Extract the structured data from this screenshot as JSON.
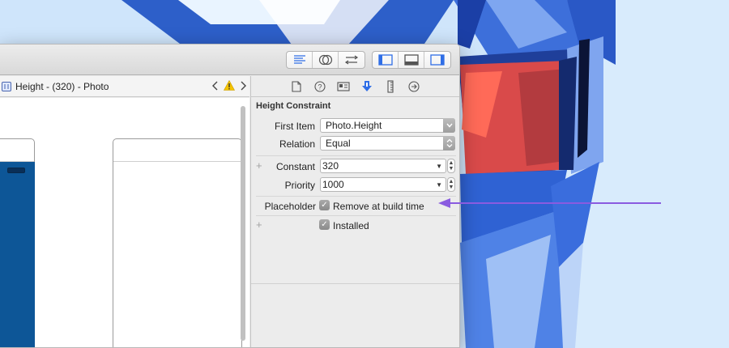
{
  "editor": {
    "breadcrumb": "Height - (320) - Photo"
  },
  "toolbar": {
    "left_group": [
      "standard-editor-icon",
      "assistant-editor-icon",
      "version-editor-icon"
    ],
    "right_group": [
      "navigator-toggle-icon",
      "debug-area-toggle-icon",
      "utilities-toggle-icon"
    ]
  },
  "inspector": {
    "tabs": [
      "file-inspector-icon",
      "quick-help-icon",
      "identity-inspector-icon",
      "attributes-inspector-icon",
      "size-inspector-icon",
      "connections-inspector-icon"
    ],
    "active_tab": "attributes-inspector-icon",
    "section_title": "Height Constraint",
    "first_item": {
      "label": "First Item",
      "value": "Photo.Height"
    },
    "relation": {
      "label": "Relation",
      "value": "Equal"
    },
    "constant": {
      "label": "Constant",
      "value": "320"
    },
    "priority": {
      "label": "Priority",
      "value": "1000"
    },
    "placeholder": {
      "label": "Placeholder",
      "checkbox_label": "Remove at build time",
      "checked": true
    },
    "installed": {
      "checkbox_label": "Installed",
      "checked": true
    },
    "plus_symbol": "+"
  },
  "annotation": {
    "color": "#8a5be0"
  },
  "colors": {
    "accent": "#2f6ee6",
    "scene_blue": "#0d5697"
  }
}
